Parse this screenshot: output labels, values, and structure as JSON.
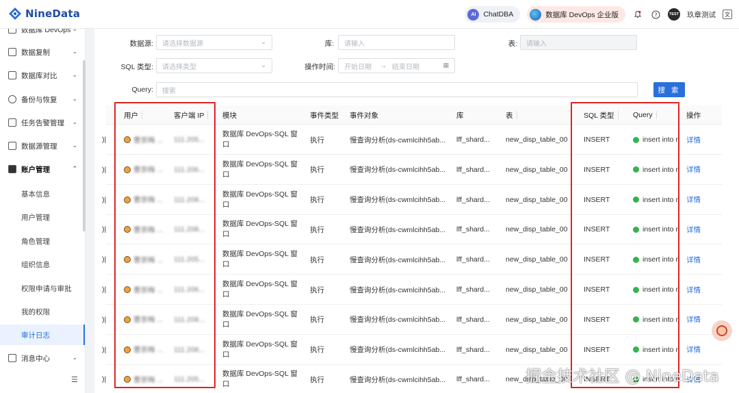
{
  "header": {
    "logo_text": "NineData",
    "chatdba_badge": "AI",
    "chatdba_label": "ChatDBA",
    "org_label": "数据库 DevOps 企业版",
    "avatar_text": "TEST",
    "user_name": "玖章测试",
    "lang_icon": "文"
  },
  "sidebar": {
    "items": [
      {
        "label": "数据库 DevOps",
        "icon": "devops-icon"
      },
      {
        "label": "数据复制",
        "icon": "replicate-icon"
      },
      {
        "label": "数据库对比",
        "icon": "compare-icon"
      },
      {
        "label": "备份与恢复",
        "icon": "backup-icon"
      },
      {
        "label": "任务告警管理",
        "icon": "alarm-icon"
      },
      {
        "label": "数据源管理",
        "icon": "datasource-icon"
      },
      {
        "label": "账户管理",
        "icon": "account-icon"
      }
    ],
    "sub_items": [
      "基本信息",
      "用户管理",
      "角色管理",
      "组织信息",
      "权限申请与审批",
      "我的权限",
      "审计日志"
    ],
    "active_sub": "审计日志",
    "bottom_item": "消息中心"
  },
  "filters": {
    "datasource_label": "数据源:",
    "datasource_placeholder": "请选择数据源",
    "db_label": "库:",
    "db_placeholder": "请输入",
    "table_label": "表:",
    "table_placeholder": "请输入",
    "sqltype_label": "SQL 类型:",
    "sqltype_placeholder": "请选择类型",
    "optime_label": "操作时间:",
    "start_placeholder": "开始日期",
    "end_placeholder": "结束日期",
    "query_label": "Query:",
    "query_placeholder": "搜索",
    "search_button": "搜 索"
  },
  "table": {
    "columns": [
      "用户",
      "客户端 IP",
      "模块",
      "事件类型",
      "事件对象",
      "库",
      "表",
      "SQL 类型",
      "Query",
      "操作"
    ],
    "rows": [
      {
        "edge": ")|",
        "user": "曹崇梅 ...",
        "ip": "111.205...",
        "module": "数据库 DevOps-SQL 窗口",
        "event": "执行",
        "object": "慢查询分析(ds-cwmlcihh5ab...",
        "db": "lff_shard...",
        "table": "new_disp_table_00",
        "sqltype": "INSERT",
        "query": "insert into n",
        "action": "详情"
      },
      {
        "edge": ")|",
        "user": "曹崇梅 ...",
        "ip": "111.206...",
        "module": "数据库 DevOps-SQL 窗口",
        "event": "执行",
        "object": "慢查询分析(ds-cwmlcihh5ab...",
        "db": "lff_shard...",
        "table": "new_disp_table_00",
        "sqltype": "INSERT",
        "query": "insert into n",
        "action": "详情"
      },
      {
        "edge": ")|",
        "user": "曹崇梅 ...",
        "ip": "111.208...",
        "module": "数据库 DevOps-SQL 窗口",
        "event": "执行",
        "object": "慢查询分析(ds-cwmlcihh5ab...",
        "db": "lff_shard...",
        "table": "new_disp_table_00",
        "sqltype": "INSERT",
        "query": "insert into n",
        "action": "详情"
      },
      {
        "edge": ")|",
        "user": "曹崇梅 ...",
        "ip": "111.208...",
        "module": "数据库 DevOps-SQL 窗口",
        "event": "执行",
        "object": "慢查询分析(ds-cwmlcihh5ab...",
        "db": "lff_shard...",
        "table": "new_disp_table_00",
        "sqltype": "INSERT",
        "query": "insert into n",
        "action": "详情"
      },
      {
        "edge": ")|",
        "user": "曹崇梅 ...",
        "ip": "111.205...",
        "module": "数据库 DevOps-SQL 窗口",
        "event": "执行",
        "object": "慢查询分析(ds-cwmlcihh5ab...",
        "db": "lff_shard...",
        "table": "new_disp_table_00",
        "sqltype": "INSERT",
        "query": "insert into n",
        "action": "详情"
      },
      {
        "edge": ")|",
        "user": "曹崇梅 ...",
        "ip": "111.206...",
        "module": "数据库 DevOps-SQL 窗口",
        "event": "执行",
        "object": "慢查询分析(ds-cwmlcihh5ab...",
        "db": "lff_shard...",
        "table": "new_disp_table_00",
        "sqltype": "INSERT",
        "query": "insert into n",
        "action": "详情"
      },
      {
        "edge": ")|",
        "user": "曹崇梅 ...",
        "ip": "111.208...",
        "module": "数据库 DevOps-SQL 窗口",
        "event": "执行",
        "object": "慢查询分析(ds-cwmlcihh5ab...",
        "db": "lff_shard...",
        "table": "new_disp_table_00",
        "sqltype": "INSERT",
        "query": "insert into n",
        "action": "详情"
      },
      {
        "edge": ")|",
        "user": "曹崇梅 ...",
        "ip": "111.208...",
        "module": "数据库 DevOps-SQL 窗口",
        "event": "执行",
        "object": "慢查询分析(ds-cwmlcihh5ab...",
        "db": "lff_shard...",
        "table": "new_disp_table_00",
        "sqltype": "INSERT",
        "query": "insert into n",
        "action": "详情"
      },
      {
        "edge": ")|",
        "user": "曹崇梅 ...",
        "ip": "111.205...",
        "module": "数据库 DevOps-SQL 窗口",
        "event": "执行",
        "object": "慢查询分析(ds-cwmlcihh5ab...",
        "db": "lff_shard...",
        "table": "new_disp_table_00",
        "sqltype": "INSERT",
        "query": "insert into n",
        "action": "详情"
      }
    ]
  },
  "watermark": "掘金技术社区 @ NineData",
  "colors": {
    "accent": "#2a6fdb",
    "highlight": "#e02020",
    "success": "#37b24d"
  }
}
